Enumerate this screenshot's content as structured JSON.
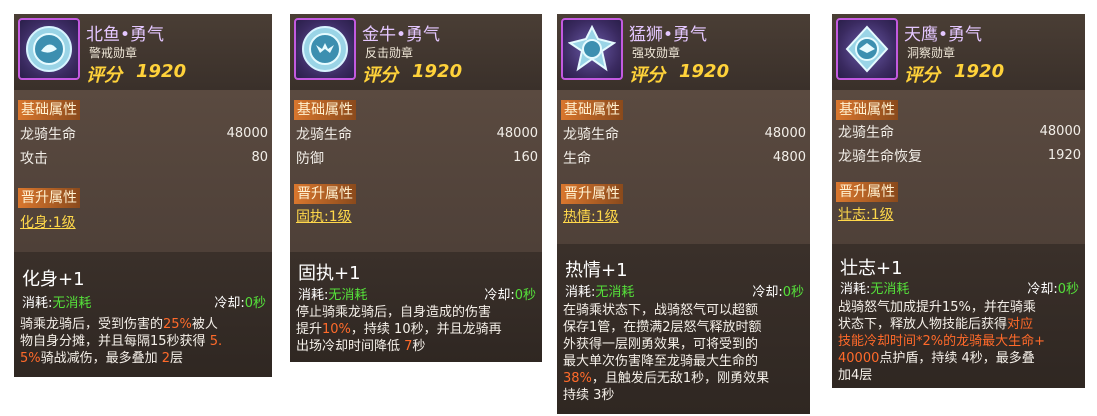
{
  "cards": [
    {
      "name": "北鱼•勇气",
      "medal": "警戒勋章",
      "score_label": "评分",
      "score": "1920",
      "base_title": "基础属性",
      "stats": [
        {
          "label": "龙骑生命",
          "value": "48000"
        },
        {
          "label": "攻击",
          "value": "80"
        }
      ],
      "up_title": "晋升属性",
      "up_link": "化身:1级",
      "skill_name": "化身+1",
      "consume_label": "消耗:",
      "consume_value": "无消耗",
      "cd_label": "冷却:",
      "cd_value": "0秒",
      "desc": [
        [
          {
            "t": "骑乘龙骑后，受到伤害的"
          },
          {
            "t": "25%",
            "hl": true
          },
          {
            "t": "被人"
          }
        ],
        [
          {
            "t": "物自身分摊，并且每隔15秒获得 "
          },
          {
            "t": "5.",
            "hl": true
          }
        ],
        [
          {
            "t": "5%",
            "hl": true
          },
          {
            "t": "骑战减伤，最多叠加 "
          },
          {
            "t": "2",
            "hl": true
          },
          {
            "t": "层"
          }
        ]
      ]
    },
    {
      "name": "金牛•勇气",
      "medal": "反击勋章",
      "score_label": "评分",
      "score": "1920",
      "base_title": "基础属性",
      "stats": [
        {
          "label": "龙骑生命",
          "value": "48000"
        },
        {
          "label": "防御",
          "value": "160"
        }
      ],
      "up_title": "晋升属性",
      "up_link": "固执:1级",
      "skill_name": "固执+1",
      "consume_label": "消耗:",
      "consume_value": "无消耗",
      "cd_label": "冷却:",
      "cd_value": "0秒",
      "desc": [
        [
          {
            "t": "停止骑乘龙骑后，自身造成的伤害"
          }
        ],
        [
          {
            "t": "提升"
          },
          {
            "t": "10%",
            "hl": true
          },
          {
            "t": "，持续 10秒，并且龙骑再"
          }
        ],
        [
          {
            "t": "出场冷却时间降低 "
          },
          {
            "t": "7",
            "hl": true
          },
          {
            "t": "秒"
          }
        ]
      ]
    },
    {
      "name": "猛狮•勇气",
      "medal": "强攻勋章",
      "score_label": "评分",
      "score": "1920",
      "base_title": "基础属性",
      "stats": [
        {
          "label": "龙骑生命",
          "value": "48000"
        },
        {
          "label": "生命",
          "value": "4800"
        }
      ],
      "up_title": "晋升属性",
      "up_link": "热情:1级",
      "skill_name": "热情+1",
      "consume_label": "消耗:",
      "consume_value": "无消耗",
      "cd_label": "冷却:",
      "cd_value": "0秒",
      "desc": [
        [
          {
            "t": "在骑乘状态下，战骑怒气可以超额"
          }
        ],
        [
          {
            "t": "保存1管，在攒满2层怒气释放时额"
          }
        ],
        [
          {
            "t": "外获得一层刚勇效果，可将受到的"
          }
        ],
        [
          {
            "t": "最大单次伤害降至龙骑最大生命的"
          }
        ],
        [
          {
            "t": "38%",
            "hl": true
          },
          {
            "t": "，且触发后无敌1秒，刚勇效果"
          }
        ],
        [
          {
            "t": "持续 3秒"
          }
        ]
      ]
    },
    {
      "name": "天鹰•勇气",
      "medal": "洞察勋章",
      "score_label": "评分",
      "score": "1920",
      "base_title": "基础属性",
      "stats": [
        {
          "label": "龙骑生命",
          "value": "48000"
        },
        {
          "label": "龙骑生命恢复",
          "value": "1920"
        }
      ],
      "up_title": "晋升属性",
      "up_link": "壮志:1级",
      "skill_name": "壮志+1",
      "consume_label": "消耗:",
      "consume_value": "无消耗",
      "cd_label": "冷却:",
      "cd_value": "0秒",
      "desc": [
        [
          {
            "t": "战骑怒气加成提升15%，并在骑乘"
          }
        ],
        [
          {
            "t": "状态下，释放人物技能后获得"
          },
          {
            "t": "对应",
            "hl": true
          }
        ],
        [
          {
            "t": "技能冷却时间*2%的龙骑最大生命+",
            "hl": true
          }
        ],
        [
          {
            "t": " 40000",
            "hl": true
          },
          {
            "t": "点护盾，持续 4秒，最多叠"
          }
        ],
        [
          {
            "t": "加4层"
          }
        ]
      ]
    }
  ]
}
